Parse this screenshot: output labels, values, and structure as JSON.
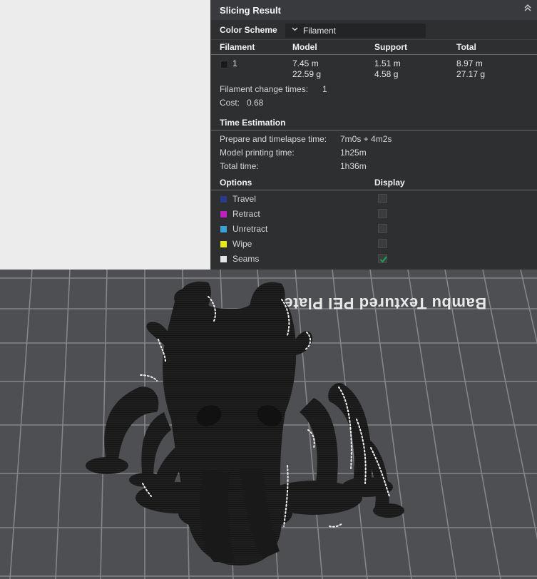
{
  "panel": {
    "title": "Slicing Result",
    "collapse_icon": "chevron-up-icon",
    "color_scheme": {
      "label": "Color Scheme",
      "value": "Filament"
    },
    "filament_table": {
      "headers": [
        "Filament",
        "Model",
        "Support",
        "Total"
      ],
      "row": {
        "index": "1",
        "swatch_color": "#1a1a1a",
        "model_length": "7.45 m",
        "model_weight": "22.59 g",
        "support_length": "1.51 m",
        "support_weight": "4.58 g",
        "total_length": "8.97 m",
        "total_weight": "27.17 g"
      }
    },
    "change_times": {
      "label": "Filament change times:",
      "value": "1"
    },
    "cost": {
      "label": "Cost:",
      "value": "0.68"
    },
    "time": {
      "header": "Time Estimation",
      "prepare": {
        "label": "Prepare and timelapse time:",
        "value": "7m0s + 4m2s"
      },
      "model": {
        "label": "Model printing time:",
        "value": "1h25m"
      },
      "total": {
        "label": "Total time:",
        "value": "1h36m"
      }
    },
    "options": {
      "header": "Options",
      "display_header": "Display",
      "items": [
        {
          "label": "Travel",
          "color": "#2b3a8f",
          "checked": false
        },
        {
          "label": "Retract",
          "color": "#c21fc2",
          "checked": false
        },
        {
          "label": "Unretract",
          "color": "#3aa3d6",
          "checked": false
        },
        {
          "label": "Wipe",
          "color": "#e8e81a",
          "checked": false
        },
        {
          "label": "Seams",
          "color": "#e6e6e6",
          "checked": true
        }
      ]
    }
  },
  "viewport": {
    "plate_label": "Bambu Textured PEI Plate",
    "plate_color": "#4d4f52",
    "grid_color": "#8a8c8f",
    "model_color": "#1c1c1c",
    "seam_color": "#f0f0f0"
  }
}
